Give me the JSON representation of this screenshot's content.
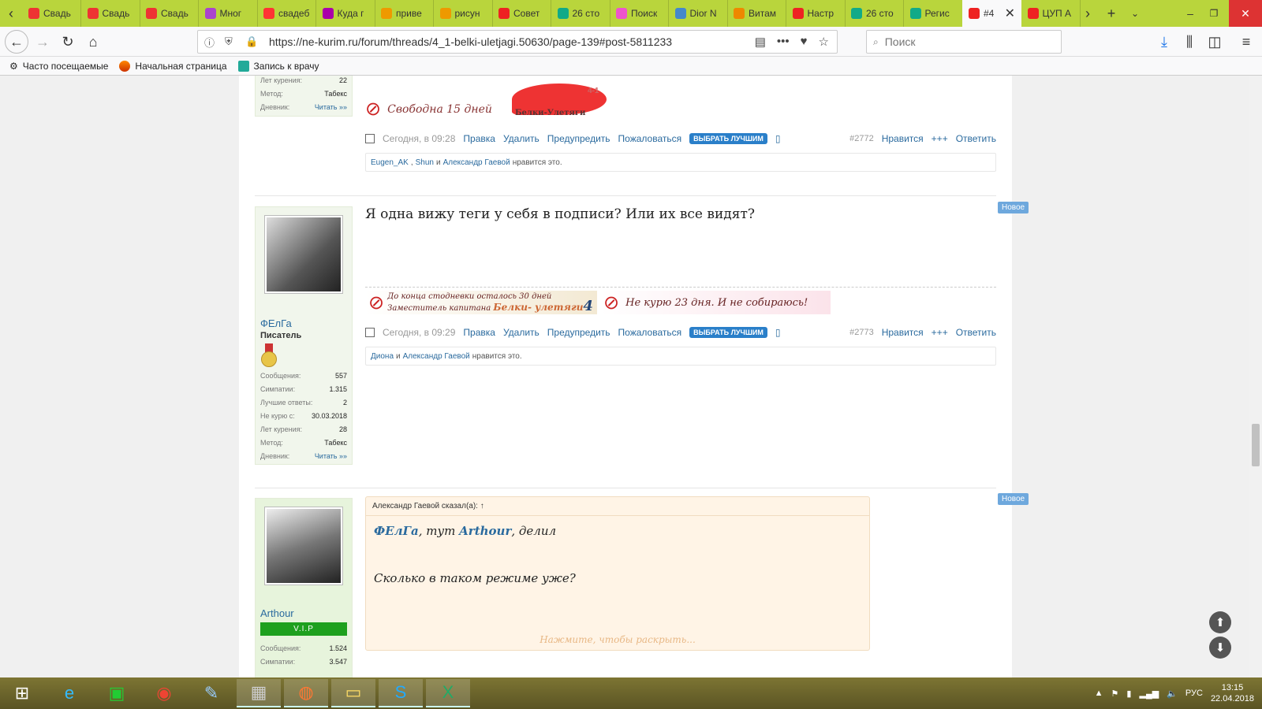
{
  "colors": {
    "tabbar": "#b9d53c",
    "link": "#2a6a9e",
    "best_button": "#2a7fc9",
    "new_badge": "#6ea8dd",
    "vip": "#1ea01e"
  },
  "browser": {
    "tabs": [
      {
        "label": "Свадь",
        "icon": "heart-icon",
        "color": "#e33"
      },
      {
        "label": "Свадь",
        "icon": "heart-icon",
        "color": "#e33"
      },
      {
        "label": "Свадь",
        "icon": "heart-icon",
        "color": "#e33"
      },
      {
        "label": "Мног",
        "icon": "pinwheel-icon",
        "color": "#a4c"
      },
      {
        "label": "свадеб",
        "icon": "yandex-icon",
        "color": "#f33"
      },
      {
        "label": "Куда г",
        "icon": "wildberries-icon",
        "color": "#a0a"
      },
      {
        "label": "приве",
        "icon": "image-icon",
        "color": "#e90"
      },
      {
        "label": "рисун",
        "icon": "image-icon",
        "color": "#e90"
      },
      {
        "label": "Совет",
        "icon": "no-entry-icon",
        "color": "#e22"
      },
      {
        "label": "26 сто",
        "icon": "sheet-icon",
        "color": "#1a8"
      },
      {
        "label": "Поиск",
        "icon": "bow-icon",
        "color": "#e5c"
      },
      {
        "label": "Dior N",
        "icon": "dots-icon",
        "color": "#48c"
      },
      {
        "label": "Витам",
        "icon": "carrot-icon",
        "color": "#e80"
      },
      {
        "label": "Настр",
        "icon": "no-entry-icon",
        "color": "#e22"
      },
      {
        "label": "26 сто",
        "icon": "sheet-icon",
        "color": "#1a8"
      },
      {
        "label": "Регис",
        "icon": "sheet-icon",
        "color": "#1a8"
      },
      {
        "label": "#4",
        "icon": "no-entry-icon",
        "color": "#e22",
        "active": true
      },
      {
        "label": "ЦУП А",
        "icon": "no-entry-icon",
        "color": "#e22"
      }
    ],
    "url": "https://ne-kurim.ru/forum/threads/4_1-belki-uletjagi.50630/page-139#post-5811233",
    "search_placeholder": "Поиск",
    "bookmarks": [
      {
        "label": "Часто посещаемые",
        "icon": "gear-icon"
      },
      {
        "label": "Начальная страница",
        "icon": "firefox-icon"
      },
      {
        "label": "Запись к врачу",
        "icon": "calendar-icon"
      }
    ]
  },
  "post_top": {
    "stats": [
      {
        "label": "Лет курения:",
        "value": "22"
      },
      {
        "label": "Метод:",
        "value": "Табекс"
      },
      {
        "label": "Дневник:",
        "value": "Читать »»"
      }
    ],
    "signature_text": "Свободна 15 дней",
    "logo_caption": "Белки-Улетяги",
    "logo_number": "4-1",
    "time": "Сегодня, в 09:28",
    "num": "#2772",
    "likes_names": [
      "Eugen_AK",
      "Shun",
      "Александр Гаевой"
    ],
    "likes_and": "и",
    "likes_suffix": "нравится это."
  },
  "post_mid": {
    "username": "ФЕлГа",
    "user_title": "Писатель",
    "badge": "Новое",
    "message": "Я одна вижу теги у себя в подписи? Или их все видят?",
    "stats": [
      {
        "label": "Сообщения:",
        "value": "557"
      },
      {
        "label": "Симпатии:",
        "value": "1.315"
      },
      {
        "label": "Лучшие ответы:",
        "value": "2"
      },
      {
        "label": "Не курю с:",
        "value": "30.03.2018"
      },
      {
        "label": "Лет курения:",
        "value": "28"
      },
      {
        "label": "Метод:",
        "value": "Табекс"
      },
      {
        "label": "Дневник:",
        "value": "Читать »»"
      }
    ],
    "sig1_line1": "До конца стодневки осталось 30 дней",
    "sig1_line2": "Заместитель капитана",
    "sig1_team": "Белки- улетяги",
    "sig1_num": "4",
    "sig2": "Не курю 23 дня. И не собираюсь!",
    "time": "Сегодня, в 09:29",
    "num": "#2773",
    "likes_names": [
      "Диона",
      "Александр Гаевой"
    ],
    "likes_and": "и",
    "likes_suffix": "нравится это."
  },
  "post_bottom": {
    "username": "Arthour",
    "vip": "V.I.P",
    "badge": "Новое",
    "quote_header": "Александр Гаевой сказал(а): ↑",
    "quote_name1": "ФЕлГа",
    "quote_mid": ", тут ",
    "quote_name2": "Arthour",
    "quote_end": ", делил",
    "quote_line2": "Сколько в таком режиме уже?",
    "expand": "Нажмите, чтобы раскрыть...",
    "stats": [
      {
        "label": "Сообщения:",
        "value": "1.524"
      },
      {
        "label": "Симпатии:",
        "value": "3.547"
      }
    ]
  },
  "actions": {
    "edit": "Правка",
    "delete": "Удалить",
    "warn": "Предупредить",
    "report": "Пожаловаться",
    "best": "ВЫБРАТЬ ЛУЧШИМ",
    "like": "Нравится",
    "more": "+++",
    "reply": "Ответить"
  },
  "taskbar": {
    "lang": "РУС",
    "time": "13:15",
    "date": "22.04.2018"
  }
}
